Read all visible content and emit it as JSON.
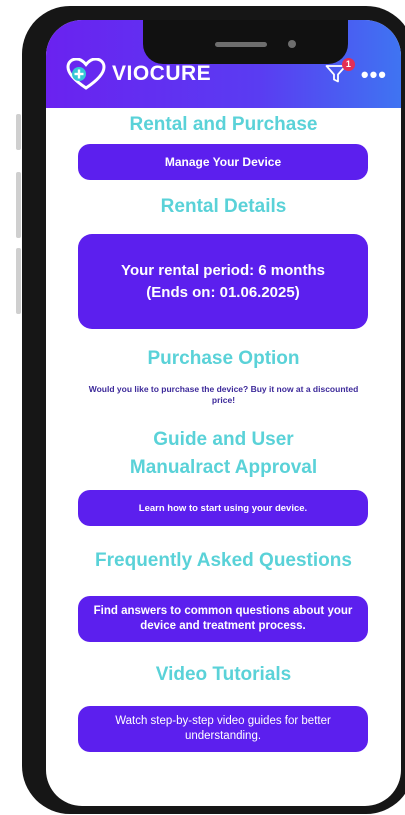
{
  "header": {
    "logo_text": "VIOCURE",
    "notification_count": "1",
    "more_label": "•••"
  },
  "colors": {
    "header_start": "#6a22f0",
    "header_end": "#3f74f2",
    "accent_teal": "#5ad2d8",
    "button_purple": "#5c1fee",
    "badge_red": "#e42e55"
  },
  "sections": {
    "rental_purchase": {
      "title": "Rental and Purchase",
      "button": "Manage Your Device"
    },
    "rental_details": {
      "title": "Rental Details",
      "line1": "Your rental period: 6 months",
      "line2": "(Ends on: 01.06.2025)"
    },
    "purchase_option": {
      "title": "Purchase Option",
      "text": "Would you like to purchase the device? Buy it now at a discounted price!"
    },
    "guide": {
      "title_line1": "Guide and User",
      "title_line2": "Manualract Approval",
      "button": "Learn how to start using your device."
    },
    "faq": {
      "title": "Frequently Asked Questions",
      "button": "Find answers to common questions about your device and treatment process."
    },
    "videos": {
      "title": "Video Tutorials",
      "button": "Watch step-by-step video guides for better understanding."
    }
  }
}
